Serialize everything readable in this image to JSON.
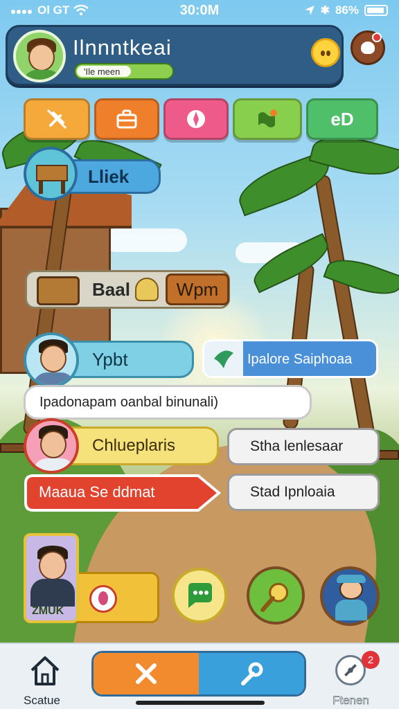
{
  "status_bar": {
    "carrier": "Ol GT",
    "time": "30:0M",
    "battery": "86%"
  },
  "header": {
    "title": "Ilnnntkeai",
    "xp_label": "'Ile meen",
    "xp_progress": 0.5
  },
  "tools": [
    {
      "name": "no-tools-icon",
      "color": "#f4a93a"
    },
    {
      "name": "briefcase-icon",
      "color": "#f07f2b"
    },
    {
      "name": "compass-icon",
      "color": "#ee5b8a"
    },
    {
      "name": "map-pin-icon",
      "color": "#88cf4e"
    },
    {
      "label": "eD",
      "color": "#4fbf6a"
    }
  ],
  "quest_pill": {
    "label": "Lliek"
  },
  "craft_panel": {
    "label": "Baal",
    "tag": "Wpm"
  },
  "row1": {
    "left_label": "Ypbt",
    "right_label": "Ipalore Saiphoaa"
  },
  "message_bar": {
    "text": "Ipadonapam oanbal binunali)"
  },
  "row2": {
    "left_label": "Chlueplaris",
    "right_label": "Stha lenlesaar"
  },
  "row3": {
    "left_label": "Maaua Se ddmat",
    "right_label": "Stad Ipnloaia"
  },
  "profile_card": {
    "name": "ZMUK"
  },
  "bottom_nav": {
    "left_label": "Scatue",
    "right_label": "Ftenen",
    "right_badge": "2"
  }
}
